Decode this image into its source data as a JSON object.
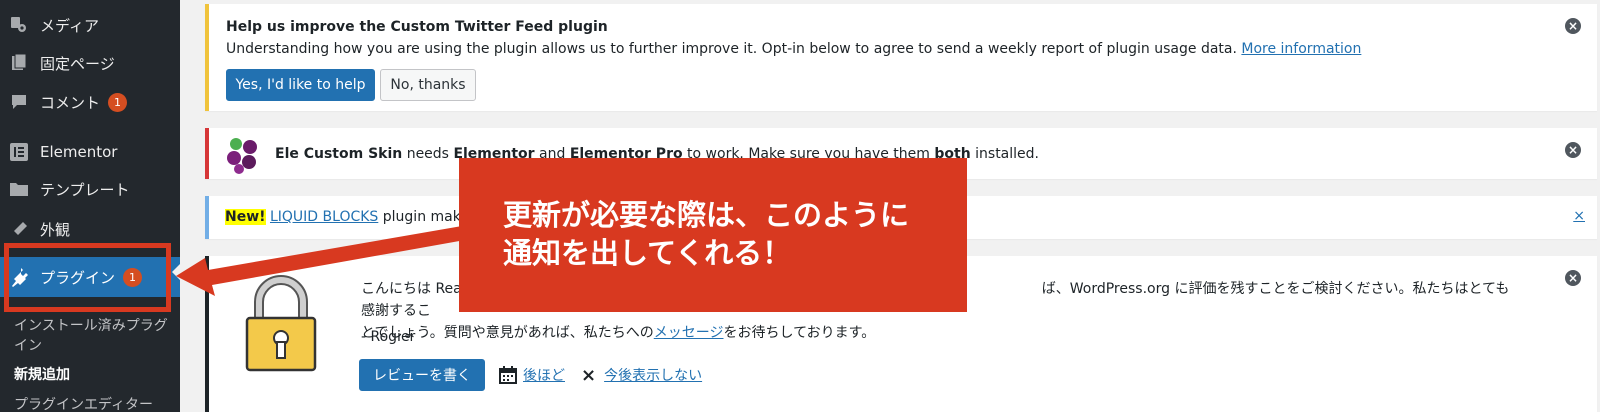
{
  "sidebar": {
    "items": [
      {
        "label": "メディア",
        "icon": "media-icon"
      },
      {
        "label": "固定ページ",
        "icon": "pages-icon"
      },
      {
        "label": "コメント",
        "icon": "comments-icon",
        "badge": "1"
      },
      {
        "label": "Elementor",
        "icon": "elementor-icon"
      },
      {
        "label": "テンプレート",
        "icon": "templates-icon"
      },
      {
        "label": "外観",
        "icon": "appearance-icon"
      },
      {
        "label": "プラグイン",
        "icon": "plugins-icon",
        "badge": "1"
      }
    ],
    "submenu": [
      {
        "label": "インストール済みプラグイン"
      },
      {
        "label": "新規追加"
      },
      {
        "label": "プラグインエディター"
      }
    ]
  },
  "notice_twitter": {
    "title": "Help us improve the Custom Twitter Feed plugin",
    "desc": "Understanding how you are using the plugin allows us to further improve it. Opt-in below to agree to send a weekly report of plugin usage data.",
    "link": "More information",
    "yes_button": "Yes, I'd like to help",
    "no_button": "No, thanks"
  },
  "notice_elementor": {
    "plugin": "Ele Custom Skin",
    "needs": " needs ",
    "dep1": "Elementor",
    "and": " and ",
    "dep2": "Elementor Pro",
    "to_work": " to work. Make sure you have them ",
    "both": "both",
    "installed": " installed."
  },
  "notice_liquid": {
    "new_tag": "New!",
    "link": "LIQUID BLOCKS",
    "text": " plugin make",
    "close": "×"
  },
  "notice_review": {
    "line1_start": "こんにちは Rea",
    "line1_end": "ば、WordPress.org に評価を残すことをご検討ください。私たちはとても感謝するこ",
    "line2_start": "とでしょう。質問や意見があれば、私たちへの",
    "line2_link": "メッセージ",
    "line2_end": "をお待ちしております。",
    "signature": "- Rogier",
    "review_button": "レビューを書く",
    "later_link": "後ほど",
    "never_link": "今後表示しない"
  },
  "callout": {
    "line1": "更新が必要な際は、このように",
    "line2": "通知を出してくれる！",
    "color": "#d83920"
  },
  "colors": {
    "sidebar_bg": "#23282d",
    "active_menu": "#2271b1",
    "badge": "#d54e21",
    "primary_button": "#2271b1"
  }
}
